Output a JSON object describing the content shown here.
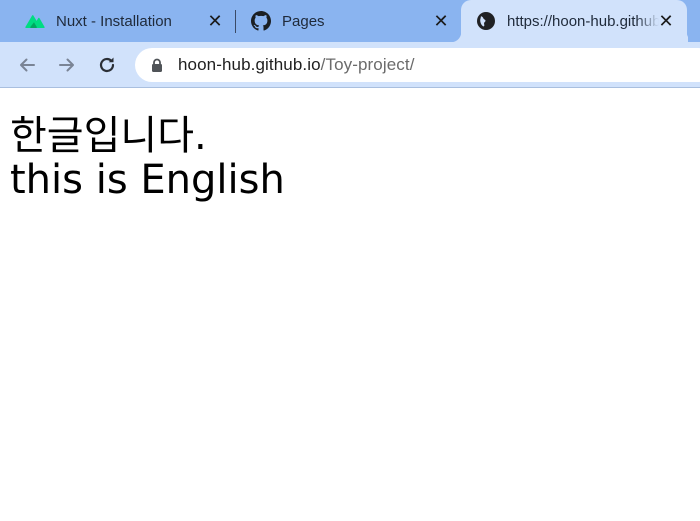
{
  "tabs": [
    {
      "title": "Nuxt - Installation",
      "icon": "nuxt-logo-icon",
      "active": false
    },
    {
      "title": "Pages",
      "icon": "github-logo-icon",
      "active": false
    },
    {
      "title": "https://hoon-hub.github.io/Toy-project/",
      "icon": "globe-icon",
      "active": true
    }
  ],
  "toolbar": {
    "back_icon": "arrow-left-icon",
    "forward_icon": "arrow-right-icon",
    "reload_icon": "reload-icon",
    "url_host": "hoon-hub.github.io",
    "url_path": "/Toy-project/",
    "lock_icon": "lock-icon"
  },
  "page": {
    "line1": "한글입니다.",
    "line2": "this is English"
  },
  "colors": {
    "tabstrip": "#8ab4f0",
    "active_tab": "#d1e2fb",
    "toolbar": "#d1e2fb",
    "nuxt_green": "#00dc82"
  }
}
